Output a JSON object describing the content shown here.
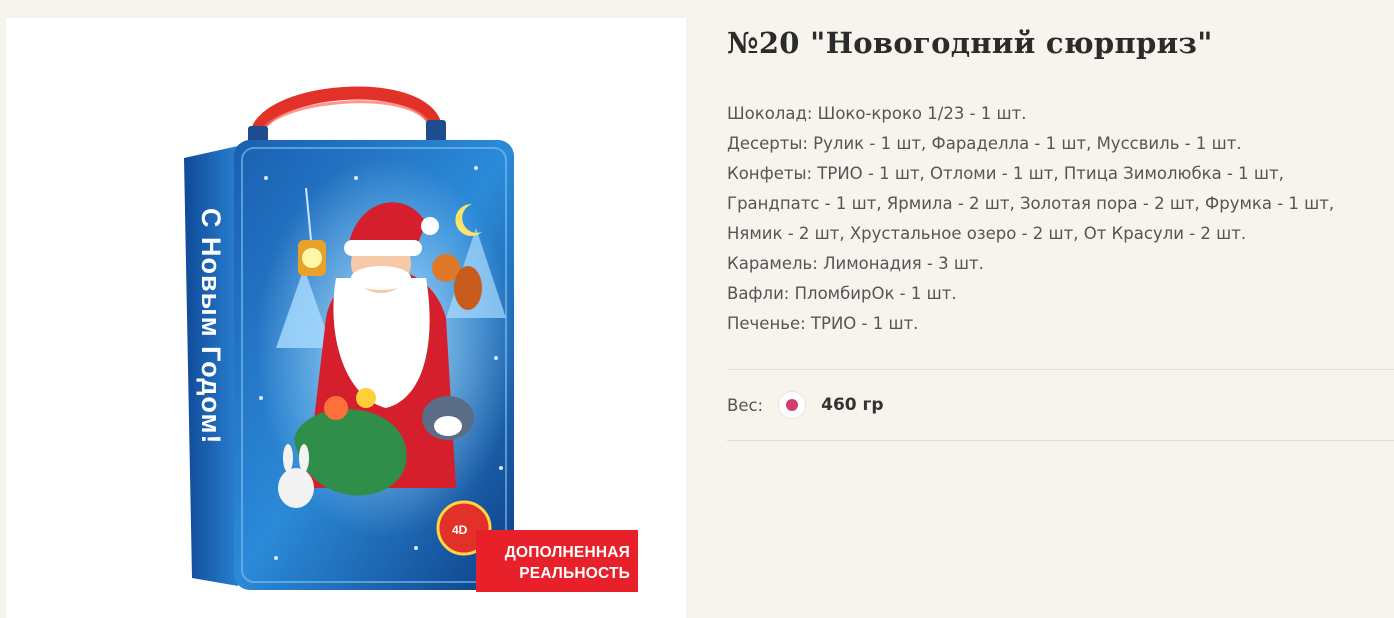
{
  "product": {
    "title": "№20 \"Новогодний сюрприз\"",
    "badge": [
      "ДОПОЛНЕННАЯ",
      "РЕАЛЬНОСТЬ"
    ],
    "composition": [
      "Шоколад: Шоко-кроко 1/23 - 1 шт.",
      "Десерты: Рулик - 1 шт, Фараделла - 1 шт, Муссвиль - 1 шт.",
      "Конфеты: ТРИО - 1 шт, Отломи - 1 шт, Птица Зимолюбка - 1 шт,",
      "Грандпатс - 1 шт, Ярмила - 2 шт, Золотая пора - 2 шт, Фрумка - 1 шт,",
      "Нямик - 2 шт, Хрустальное озеро - 2 шт, От Красули - 2 шт.",
      "Карамель: Лимонадия - 3 шт.",
      "Вафли: ПломбирОк - 1 шт.",
      "Печенье: ТРИО     - 1 шт."
    ],
    "weight_label": "Вес:",
    "weight_value": "460 гр"
  },
  "colors": {
    "accent": "#d23f6e",
    "badge": "#e8202a",
    "tin": "#1f6fbf",
    "handle": "#e23128"
  },
  "icons": [
    "radio-selected-icon"
  ]
}
